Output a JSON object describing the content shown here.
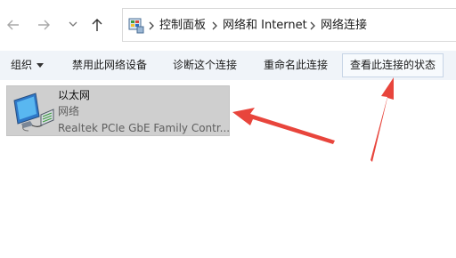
{
  "nav": {
    "back_icon": "arrow-left-icon",
    "forward_icon": "arrow-right-icon",
    "recent_icon": "chevron-down-icon",
    "up_icon": "arrow-up-icon"
  },
  "address": {
    "icon": "control-panel-icon",
    "crumbs": [
      "控制面板",
      "网络和 Internet",
      "网络连接"
    ]
  },
  "toolbar": {
    "organize": "组织",
    "disable": "禁用此网络设备",
    "diagnose": "诊断这个连接",
    "rename": "重命名此连接",
    "view_status": "查看此连接的状态"
  },
  "connection": {
    "name": "以太网",
    "status": "网络",
    "device": "Realtek PCIe GbE Family Contr..."
  },
  "annotations": {
    "color": "#e8453c"
  }
}
